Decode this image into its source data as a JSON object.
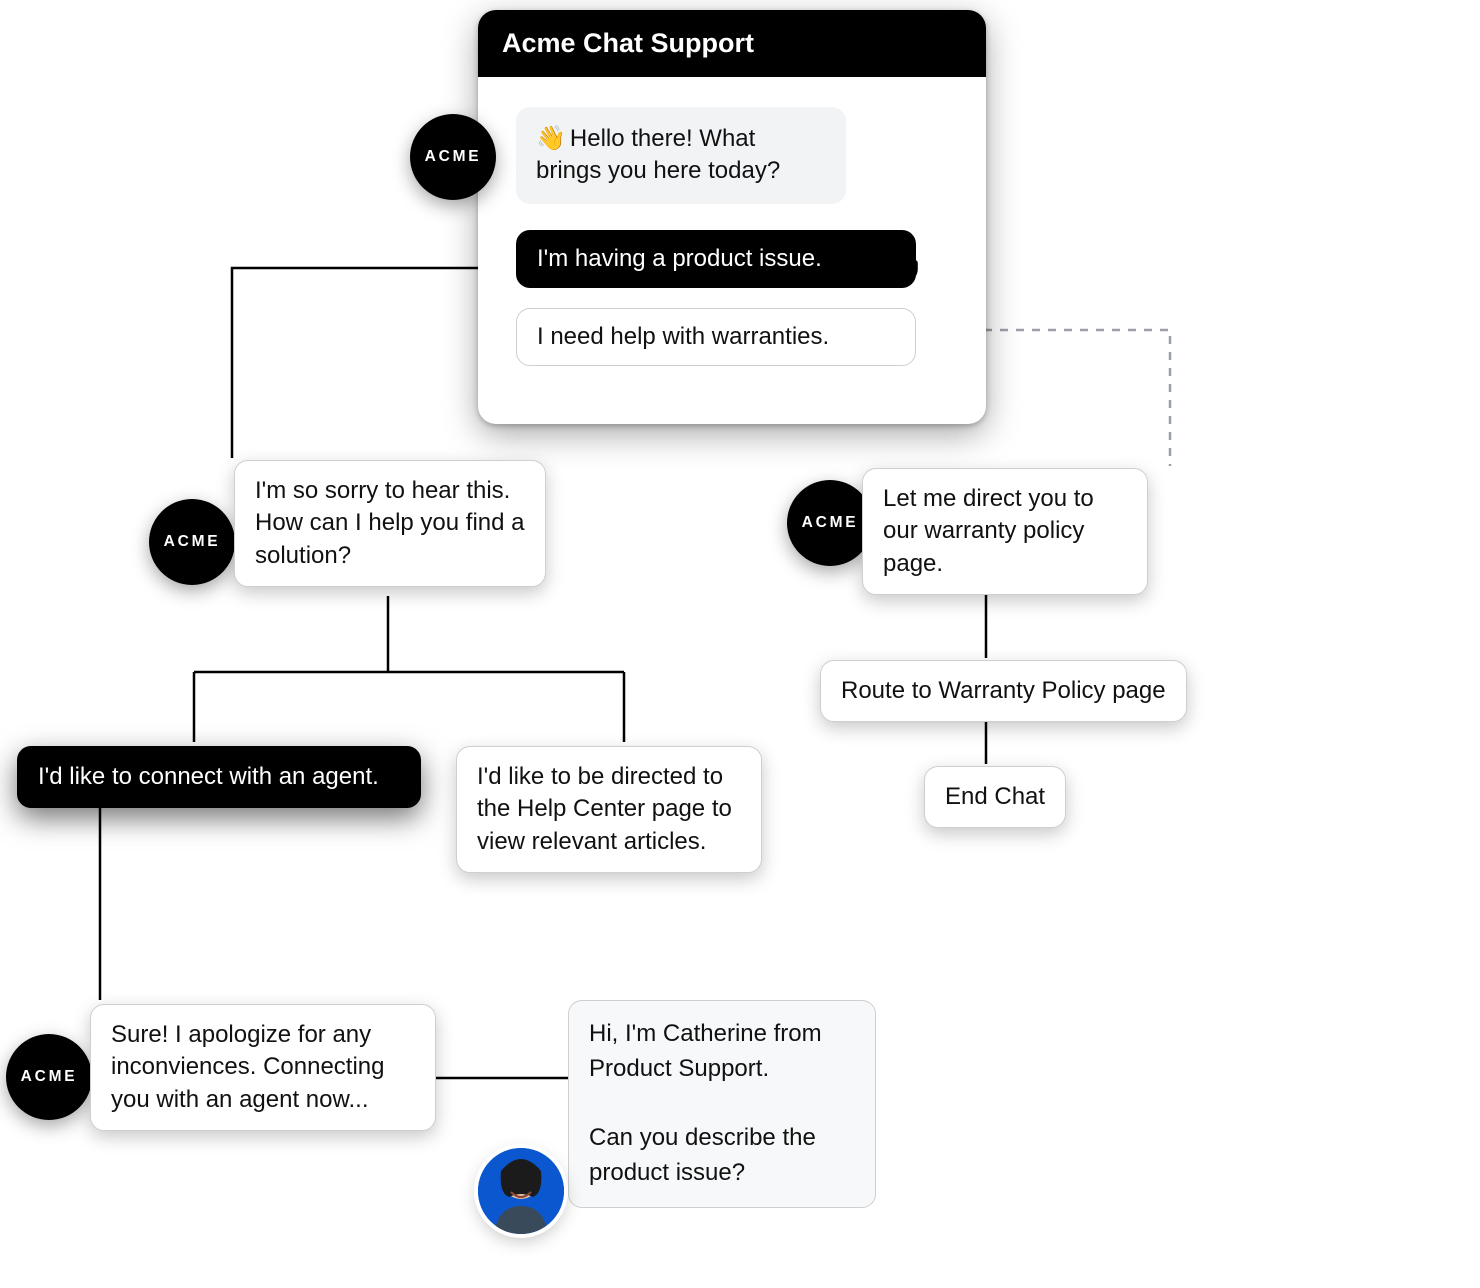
{
  "widget": {
    "title": "Acme Chat Support",
    "greeting_emoji": "👋",
    "greeting": "Hello there! What brings you here today?",
    "option_selected": "I'm having a product issue.",
    "option_other": "I need help with warranties."
  },
  "badge": {
    "label": "ACME"
  },
  "left": {
    "sorry": "I'm so sorry to hear this. How can I help you find a solution?",
    "opt_agent": "I'd like to connect with an agent.",
    "opt_help": "I'd like to be directed to the Help Center page to view relevant articles.",
    "connecting": "Sure! I apologize for any inconviences. Connecting you with an agent now...",
    "agent_msg": "Hi, I'm Catherine from Product Support.\n\nCan you describe the product issue?"
  },
  "right": {
    "warranty": "Let me direct you to our warranty policy page.",
    "route": "Route to Warranty Policy page",
    "end": "End Chat"
  }
}
